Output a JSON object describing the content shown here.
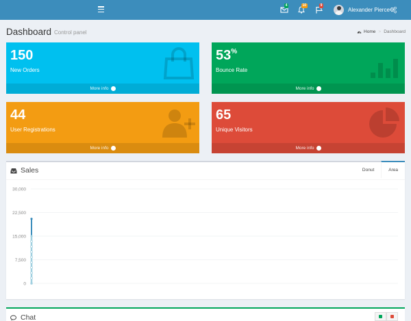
{
  "topbar": {
    "nav_items": [
      {
        "icon": "envelope-icon",
        "badge": "4",
        "badge_color": "#00a65a"
      },
      {
        "icon": "bell-icon",
        "badge": "10",
        "badge_color": "#f39c12"
      },
      {
        "icon": "flag-icon",
        "badge": "9",
        "badge_color": "#dd4b39"
      }
    ],
    "user_name": "Alexander Pierce",
    "accent": "#3c8dbc"
  },
  "header": {
    "title": "Dashboard",
    "subtitle": "Control panel",
    "breadcrumb": {
      "home": "Home",
      "current": "Dashboard"
    }
  },
  "stats": [
    {
      "value": "150",
      "suffix": "",
      "label": "New Orders",
      "more": "More info",
      "color": "#00c0ef",
      "icon": "shopping-bag-icon"
    },
    {
      "value": "53",
      "suffix": "%",
      "label": "Bounce Rate",
      "more": "More info",
      "color": "#00a65a",
      "icon": "bar-chart-icon"
    },
    {
      "value": "44",
      "suffix": "",
      "label": "User Registrations",
      "more": "More info",
      "color": "#f39c12",
      "icon": "user-plus-icon"
    },
    {
      "value": "65",
      "suffix": "",
      "label": "Unique Visitors",
      "more": "More info",
      "color": "#dd4b39",
      "icon": "pie-chart-icon"
    }
  ],
  "sales": {
    "title": "Sales",
    "tabs": [
      "Donut",
      "Area"
    ],
    "active_tab": "Area"
  },
  "chart_data": {
    "type": "area",
    "title": "",
    "xlabel": "",
    "ylabel": "",
    "ylim": [
      0,
      30000
    ],
    "yticks": [
      "0",
      "7,500",
      "15,000",
      "22,500",
      "30,000"
    ],
    "grid": true,
    "series": [
      {
        "values": [
          0,
          20500
        ],
        "color": "#3c8dbc"
      },
      {
        "values": [
          0,
          15000
        ],
        "color": "#a0d0e0"
      }
    ]
  },
  "chat": {
    "title": "Chat",
    "tools": [
      {
        "color": "#00a65a"
      },
      {
        "color": "#dd4b39"
      }
    ]
  }
}
